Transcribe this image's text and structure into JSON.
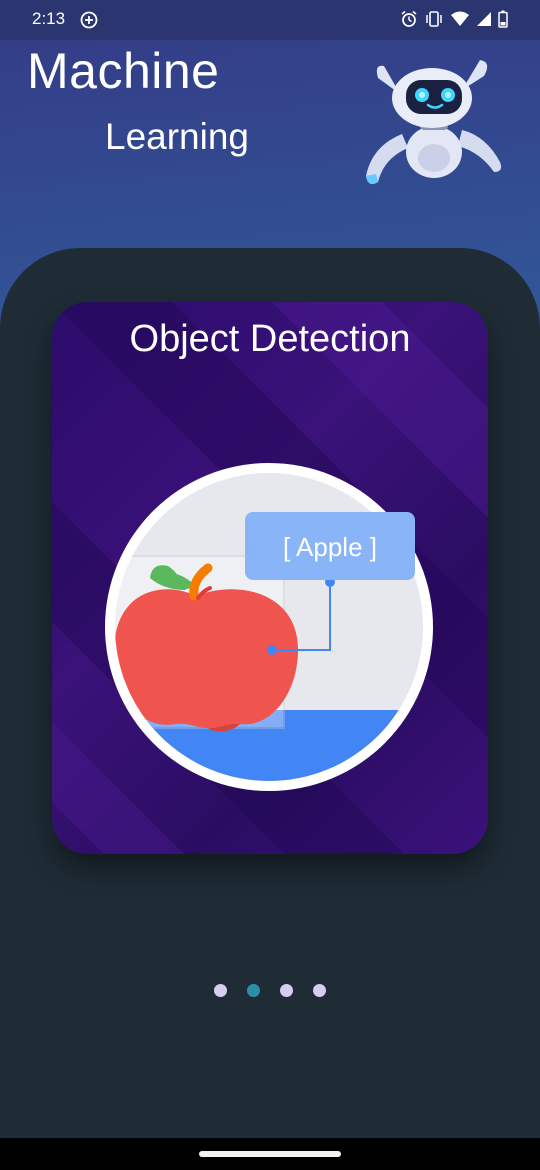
{
  "status_bar": {
    "time": "2:13",
    "icons": [
      "add-circle-icon",
      "alarm-icon",
      "vibrate-icon",
      "wifi-icon",
      "signal-icon",
      "battery-icon"
    ]
  },
  "header": {
    "title_line1": "Machine",
    "title_line2": "Learning",
    "mascot": "robot-mascot"
  },
  "card": {
    "title": "Object Detection",
    "detection_label": "[ Apple ]"
  },
  "pager": {
    "count": 4,
    "active_index": 1
  },
  "colors": {
    "header_gradient_start": "#343a86",
    "header_gradient_end": "#1e8fa6",
    "panel": "#1f2c36",
    "card": "#2b0b6b",
    "dot_inactive": "#d6cdf1",
    "dot_active": "#2a8fa8",
    "label_bg": "#8ab4f8",
    "apple_red": "#f0544f"
  }
}
